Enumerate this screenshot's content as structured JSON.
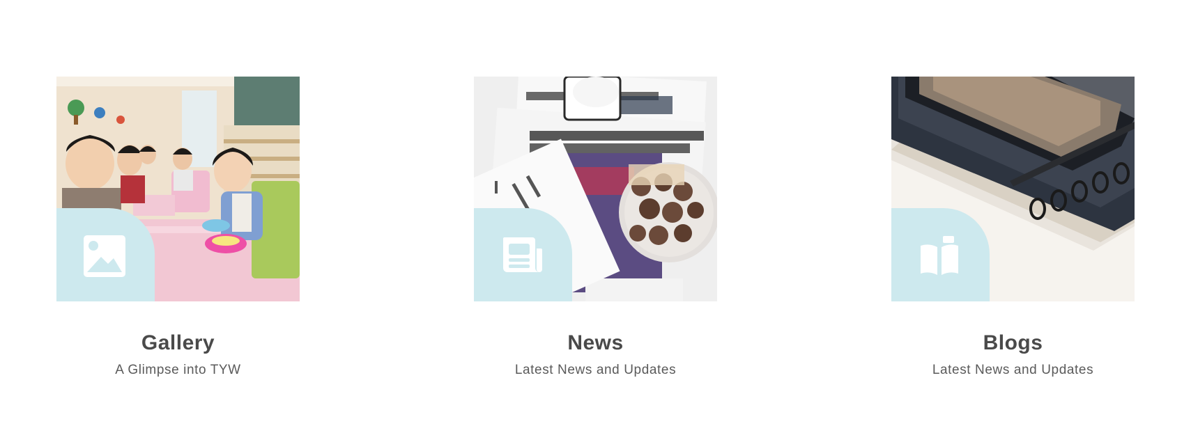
{
  "cards": [
    {
      "title": "Gallery",
      "subtitle": "A Glimpse into TYW",
      "icon": "image-icon"
    },
    {
      "title": "News",
      "subtitle": "Latest News and Updates",
      "icon": "newspaper-icon"
    },
    {
      "title": "Blogs",
      "subtitle": "Latest News and Updates",
      "icon": "book-icon"
    }
  ],
  "colors": {
    "badge": "#cde9ee",
    "title": "#4a4a4a",
    "subtitle": "#5a5a5a"
  }
}
